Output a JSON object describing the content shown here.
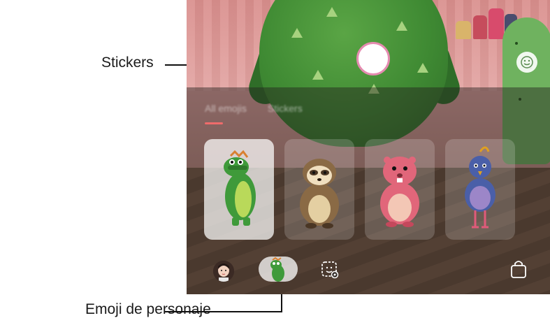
{
  "callouts": {
    "stickers_label": "Stickers",
    "character_emoji_label": "Emoji de personaje"
  },
  "tabs": [
    {
      "label": "All emojis",
      "selected": true
    },
    {
      "label": "Stickers",
      "selected": false
    }
  ],
  "characters": [
    {
      "name": "dinosaur",
      "selected": true
    },
    {
      "name": "sloth",
      "selected": false
    },
    {
      "name": "pink-beaver",
      "selected": false
    },
    {
      "name": "blue-bird",
      "selected": false
    }
  ],
  "bottom_bar": {
    "items": [
      "my-emoji-avatar",
      "character-emoji",
      "stickers",
      "store"
    ],
    "selected": "character-emoji"
  },
  "colors": {
    "accent_underline": "#ef6b6b",
    "shutter_ring": "#e58bb0"
  }
}
